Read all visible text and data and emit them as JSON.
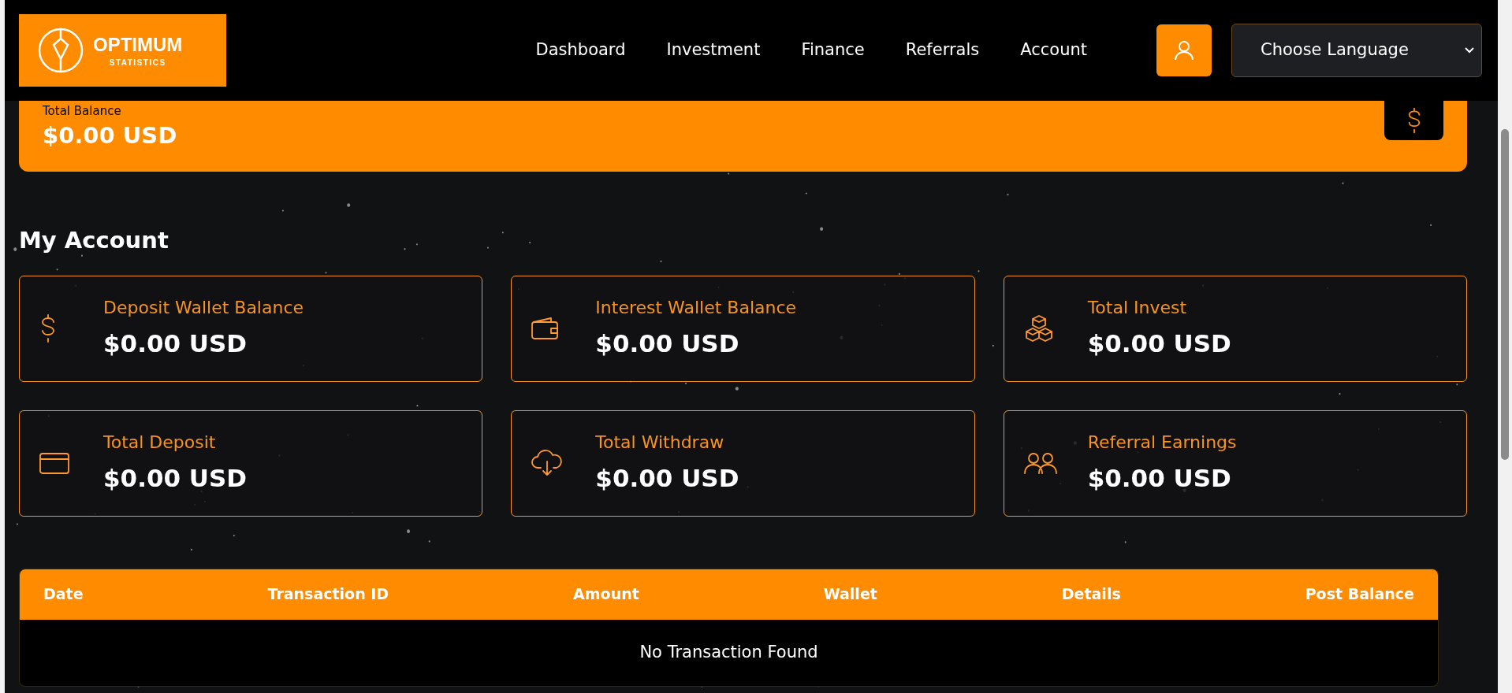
{
  "header": {
    "logo": {
      "name": "OPTIMUM",
      "tagline": "STATISTICS"
    },
    "nav": [
      {
        "label": "Dashboard"
      },
      {
        "label": "Investment"
      },
      {
        "label": "Finance"
      },
      {
        "label": "Referrals"
      },
      {
        "label": "Account"
      }
    ],
    "language_select": {
      "value": "Choose Language"
    }
  },
  "balance": {
    "label": "Total Balance",
    "amount": "$0.00 USD"
  },
  "section_title": "My Account",
  "stats": [
    {
      "kind": "dollar",
      "label": "Deposit Wallet Balance",
      "amount": "$0.00 USD"
    },
    {
      "kind": "wallet",
      "label": "Interest Wallet Balance",
      "amount": "$0.00 USD"
    },
    {
      "kind": "cubes",
      "label": "Total Invest",
      "amount": "$0.00 USD"
    },
    {
      "kind": "card",
      "label": "Total Deposit",
      "amount": "$0.00 USD"
    },
    {
      "kind": "cloud",
      "label": "Total Withdraw",
      "amount": "$0.00 USD"
    },
    {
      "kind": "users",
      "label": "Referral Earnings",
      "amount": "$0.00 USD"
    }
  ],
  "table": {
    "columns": [
      "Date",
      "Transaction ID",
      "Amount",
      "Wallet",
      "Details",
      "Post Balance"
    ],
    "empty_message": "No Transaction Found"
  }
}
